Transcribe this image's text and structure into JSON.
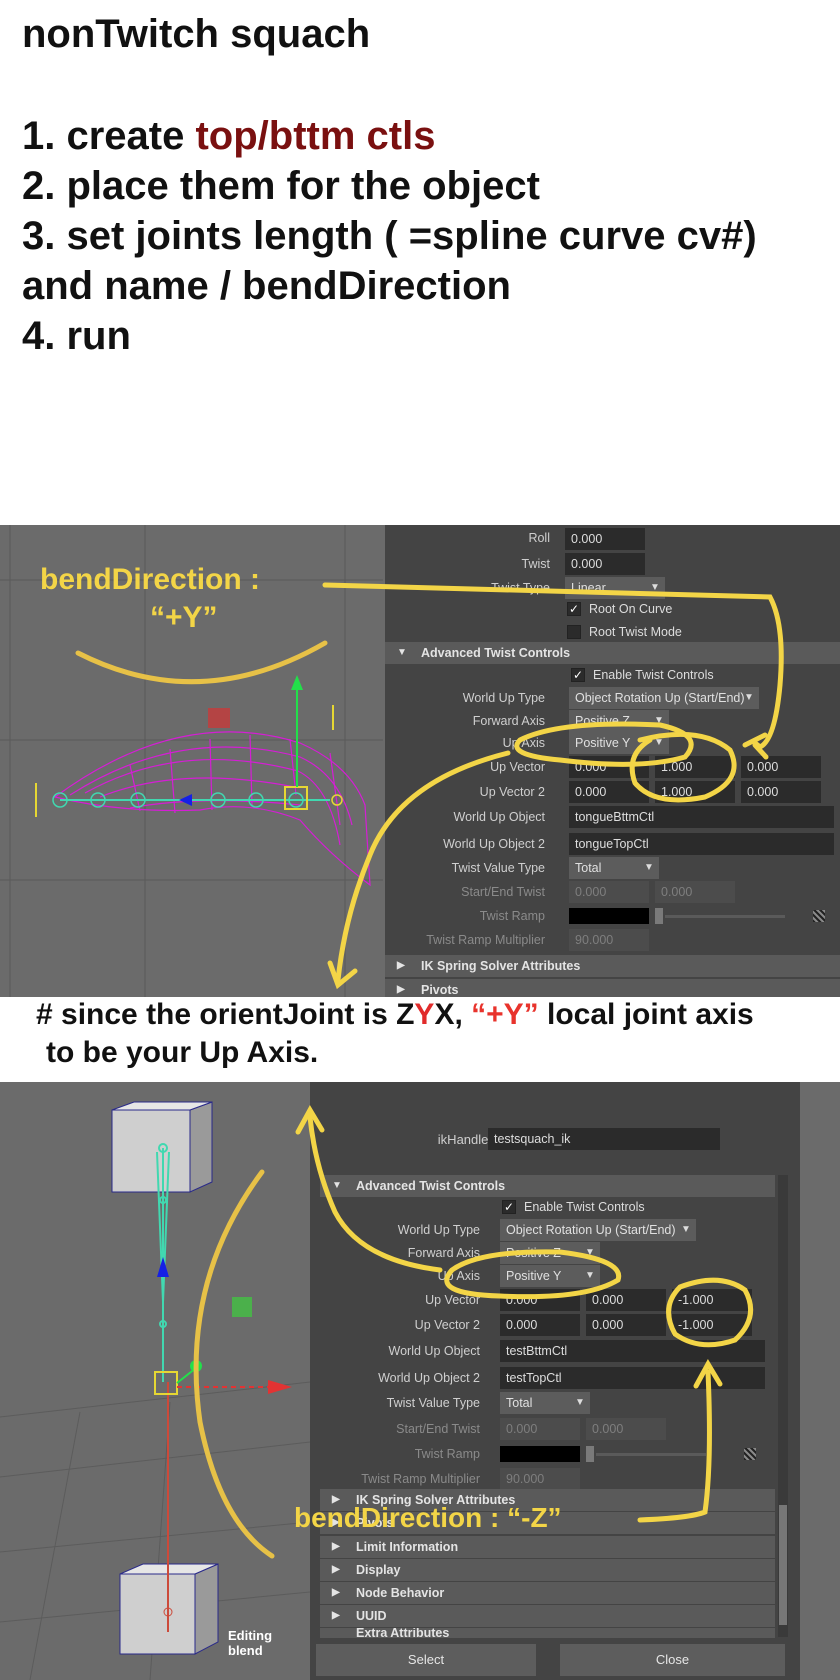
{
  "header": {
    "title": "nonTwitch squach",
    "steps": [
      {
        "prefix": "1. create ",
        "highlight": "top/bttm ctls"
      },
      {
        "text": "2. place them for the object"
      },
      {
        "text": "3. set joints length ( =spline curve cv#)"
      },
      {
        "text": "and name / bendDirection"
      },
      {
        "text": "4. run"
      }
    ]
  },
  "panel1": {
    "overlay_label": "bendDirection :",
    "overlay_value": "“+Y”",
    "attrs": {
      "roll_label": "Roll",
      "roll_value": "0.000",
      "twist_label": "Twist",
      "twist_value": "0.000",
      "twist_type_label": "Twist Type",
      "twist_type_value": "Linear",
      "root_on_curve": "Root On Curve",
      "root_twist_mode": "Root Twist Mode",
      "section_advanced": "Advanced Twist Controls",
      "enable_twist": "Enable Twist Controls",
      "world_up_type_label": "World Up Type",
      "world_up_type_value": "Object Rotation Up (Start/End)",
      "forward_axis_label": "Forward Axis",
      "forward_axis_value": "Positive Z",
      "up_axis_label": "Up Axis",
      "up_axis_value": "Positive Y",
      "up_vector_label": "Up Vector",
      "up_vector": [
        "0.000",
        "1.000",
        "0.000"
      ],
      "up_vector2_label": "Up Vector 2",
      "up_vector2": [
        "0.000",
        "1.000",
        "0.000"
      ],
      "world_up_object_label": "World Up Object",
      "world_up_object_value": "tongueBttmCtl",
      "world_up_object2_label": "World Up Object 2",
      "world_up_object2_value": "tongueTopCtl",
      "twist_value_type_label": "Twist Value Type",
      "twist_value_type_value": "Total",
      "start_end_twist_label": "Start/End Twist",
      "start_end_twist": [
        "0.000",
        "0.000"
      ],
      "twist_ramp_label": "Twist Ramp",
      "twist_ramp_mult_label": "Twist Ramp Multiplier",
      "twist_ramp_mult_value": "90.000",
      "section_ik_spring": "IK Spring Solver Attributes",
      "section_pivots": "Pivots"
    }
  },
  "note": {
    "line1_a": "# since the orientJoint is Z",
    "line1_y": "Y",
    "line1_b": "X, ",
    "line1_plus": "“+Y”",
    "line1_c": " local joint axis",
    "line2": "to be your Up Axis."
  },
  "panel2": {
    "window_title": "testsquach_ik",
    "ikhandle_label": "ikHandle:",
    "ikhandle_value": "testsquach_ik",
    "section_advanced": "Advanced Twist Controls",
    "enable_twist": "Enable Twist Controls",
    "world_up_type_label": "World Up Type",
    "world_up_type_value": "Object Rotation Up (Start/End)",
    "forward_axis_label": "Forward Axis",
    "forward_axis_value": "Positive Z",
    "up_axis_label": "Up Axis",
    "up_axis_value": "Positive Y",
    "up_vector_label": "Up Vector",
    "up_vector": [
      "0.000",
      "0.000",
      "-1.000"
    ],
    "up_vector2_label": "Up Vector 2",
    "up_vector2": [
      "0.000",
      "0.000",
      "-1.000"
    ],
    "world_up_object_label": "World Up Object",
    "world_up_object_value": "testBttmCtl",
    "world_up_object2_label": "World Up Object 2",
    "world_up_object2_value": "testTopCtl",
    "twist_value_type_label": "Twist Value Type",
    "twist_value_type_value": "Total",
    "start_end_twist_label": "Start/End Twist",
    "start_end_twist": [
      "0.000",
      "0.000"
    ],
    "twist_ramp_label": "Twist Ramp",
    "twist_ramp_mult_label": "Twist Ramp Multiplier",
    "twist_ramp_mult_value": "90.000",
    "sections": [
      "IK Spring Solver Attributes",
      "Pivots",
      "Limit Information",
      "Display",
      "Node Behavior",
      "UUID",
      "Extra Attributes"
    ],
    "overlay_label": "bendDirection : “-Z”",
    "editing_text": "Editing blend",
    "select_button": "Select",
    "close_button": "Close"
  },
  "colors": {
    "annotation": "#f3d547",
    "panel_bg": "#444444",
    "viewport_bg": "#6b6b6b",
    "highlight_red": "#7a1010"
  }
}
